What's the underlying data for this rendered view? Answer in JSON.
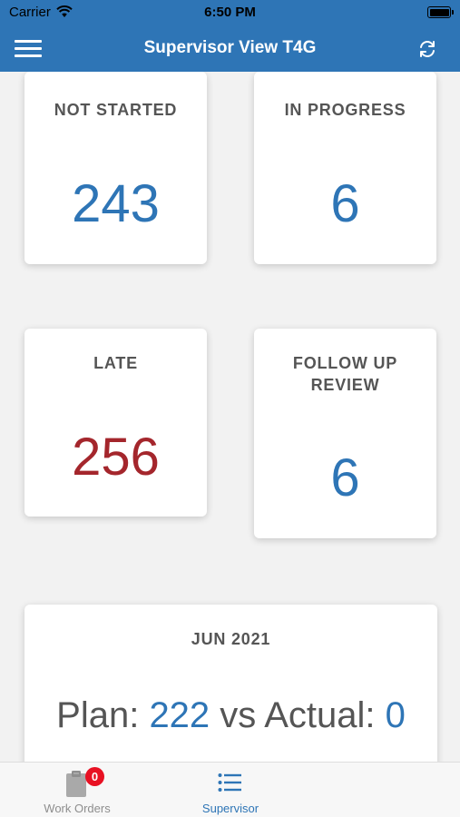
{
  "status_bar": {
    "carrier": "Carrier",
    "time": "6:50 PM"
  },
  "nav": {
    "title": "Supervisor View T4G"
  },
  "cards": [
    {
      "label": "NOT STARTED",
      "value": "243",
      "color": "#2e75b6"
    },
    {
      "label": "IN PROGRESS",
      "value": "6",
      "color": "#2e75b6"
    },
    {
      "label": "LATE",
      "value": "256",
      "color": "#a4262c"
    },
    {
      "label": "FOLLOW UP\nREVIEW",
      "value": "6",
      "color": "#2e75b6"
    }
  ],
  "month": {
    "label": "JUN 2021",
    "plan_prefix": "Plan: ",
    "plan_value": "222",
    "vs_text": " vs Actual: ",
    "actual_value": "0"
  },
  "tabs": [
    {
      "label": "Work Orders",
      "badge": "0",
      "active": false
    },
    {
      "label": "Supervisor",
      "active": true
    }
  ],
  "colors": {
    "primary": "#2e75b6",
    "late": "#a4262c",
    "badge": "#e81123",
    "tab_inactive": "#8e8e8e"
  }
}
